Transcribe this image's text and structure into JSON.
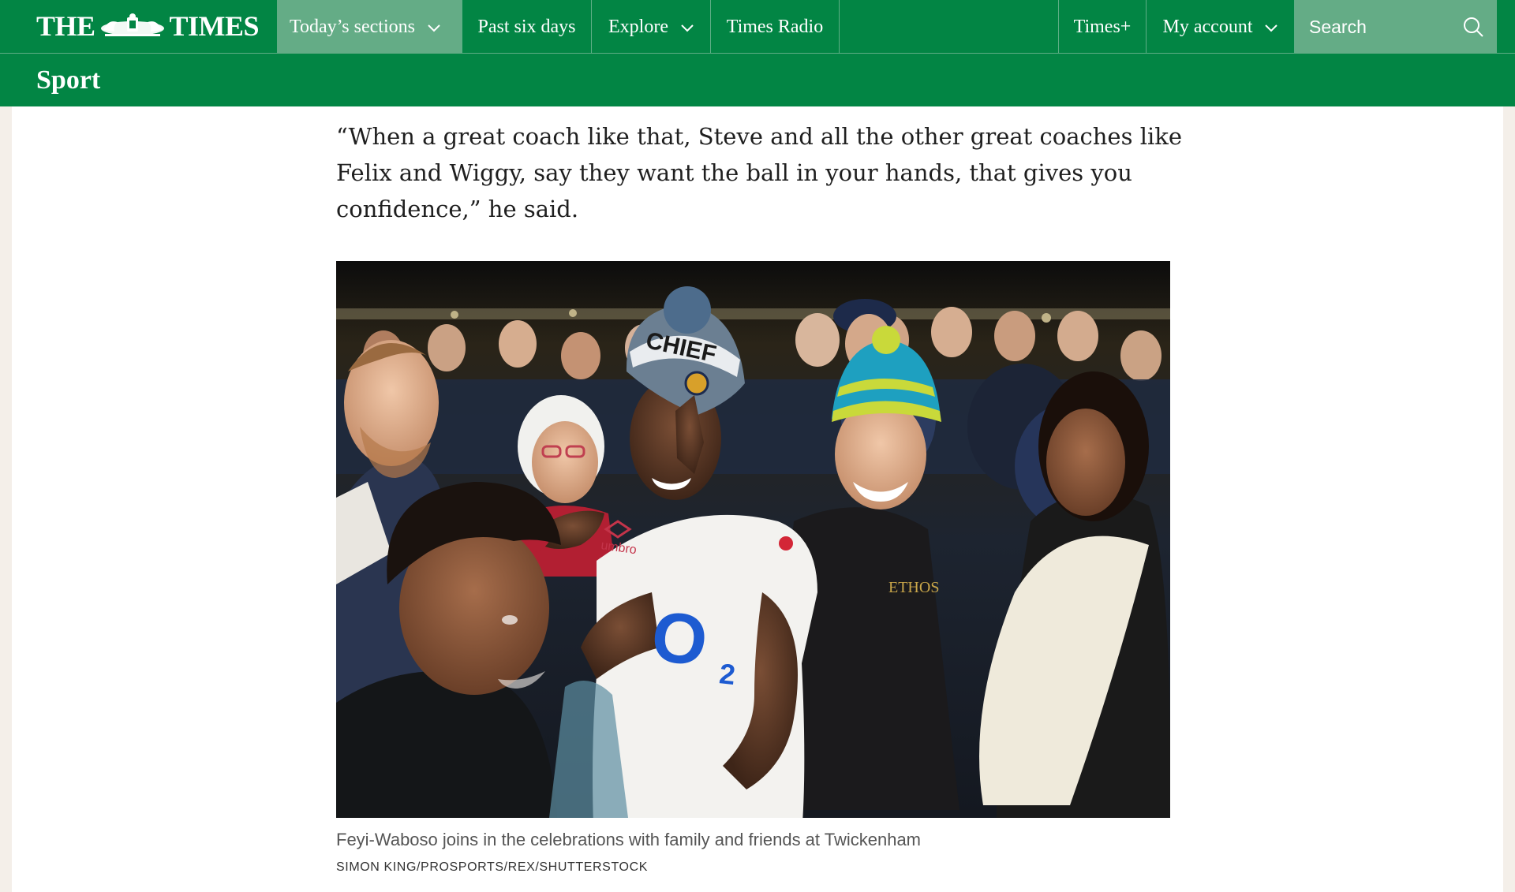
{
  "header": {
    "logo_left": "THE",
    "logo_right": "TIMES",
    "nav": {
      "sections": "Today’s sections",
      "past_six_days": "Past six days",
      "explore": "Explore",
      "times_radio": "Times Radio",
      "times_plus": "Times+",
      "my_account": "My account"
    },
    "search_placeholder": "Search",
    "icons": {
      "crest": "royal-crest-icon",
      "chevron": "chevron-down-icon",
      "search": "search-icon"
    }
  },
  "section": {
    "title": "Sport"
  },
  "article": {
    "quote": "“When a great coach like that, Steve and all the other great coaches like Felix and Wiggy, say they want the ball in your hands, that gives you confidence,” he said.",
    "image": {
      "jersey_sponsor": "O",
      "jersey_sponsor_sub": "2",
      "hat_text": "CHIEF",
      "jacket_text": "ETHOS",
      "kit_brand": "umbro"
    },
    "caption": "Feyi-Waboso joins in the celebrations with family and friends at Twickenham",
    "credit": "SIMON KING/PROSPORTS/REX/SHUTTERSTOCK"
  },
  "colors": {
    "brand_green": "#028544",
    "nav_highlight": "#64ac86",
    "page_background": "#f4efe9"
  }
}
